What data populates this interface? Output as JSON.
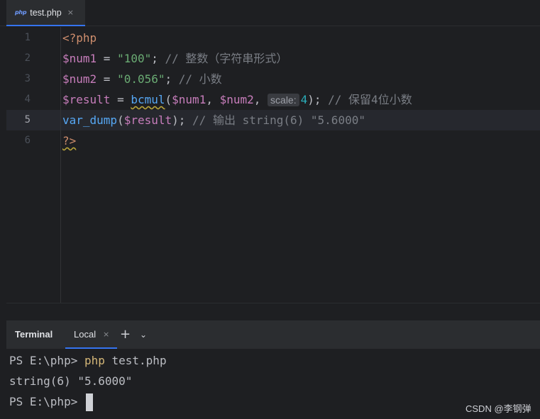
{
  "tab": {
    "icon_text": "php",
    "filename": "test.php",
    "close": "×"
  },
  "editor": {
    "line_numbers": [
      "1",
      "2",
      "3",
      "4",
      "5",
      "6"
    ],
    "line1": {
      "open_tag": "<?php"
    },
    "line2": {
      "var": "$num1",
      "eq": " = ",
      "str": "\"100\"",
      "semi": "; ",
      "comment": "// 整数（字符串形式）"
    },
    "line3": {
      "var": "$num2",
      "eq": " = ",
      "str": "\"0.056\"",
      "semi": "; ",
      "comment": "// 小数"
    },
    "line4": {
      "var": "$result",
      "eq": " = ",
      "fn": "bcmul",
      "open": "(",
      "arg1": "$num1",
      "c1": ", ",
      "arg2": "$num2",
      "c2": ", ",
      "hint": "scale:",
      "num": "4",
      "close": "); ",
      "comment": "// 保留4位小数"
    },
    "line5": {
      "fn": "var_dump",
      "open": "(",
      "arg": "$result",
      "close": "); ",
      "comment": "// 输出 string(6) \"5.6000\""
    },
    "line6": {
      "close_tag": "?>"
    }
  },
  "terminal_bar": {
    "title": "Terminal",
    "tab_label": "Local",
    "tab_close": "×",
    "plus": "+",
    "chevron": "⌄"
  },
  "terminal": {
    "line1_prompt": "PS E:\\php> ",
    "line1_cmd": "php",
    "line1_rest": " test.php",
    "line2": "string(6) \"5.6000\"",
    "line3_prompt": "PS E:\\php> "
  },
  "watermark": "CSDN @李钢弹",
  "colors": {
    "background": "#1e1f22",
    "accent": "#3574f0",
    "keyword": "#cf8e6d",
    "variable": "#c77dbb",
    "string": "#6aab73",
    "function": "#56a8f5",
    "comment": "#7a7e85"
  }
}
